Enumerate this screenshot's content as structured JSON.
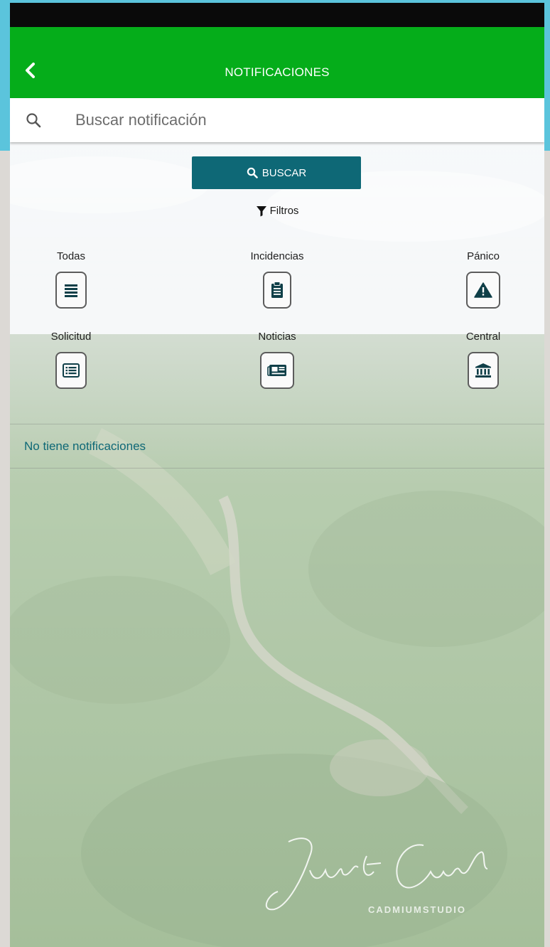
{
  "appbar": {
    "title": "NOTIFICACIONES",
    "back_icon": "chevron-left-icon"
  },
  "search": {
    "placeholder": "Buscar notificación",
    "value": ""
  },
  "actions": {
    "buscar_label": "BUSCAR",
    "filtros_label": "Filtros"
  },
  "categories": [
    {
      "label": "Todas",
      "icon": "list-icon"
    },
    {
      "label": "Incidencias",
      "icon": "clipboard-icon"
    },
    {
      "label": "Pánico",
      "icon": "warning-icon"
    },
    {
      "label": "Solicitud",
      "icon": "list-alt-icon"
    },
    {
      "label": "Noticias",
      "icon": "newspaper-icon"
    },
    {
      "label": "Central",
      "icon": "bank-icon"
    }
  ],
  "notifications": {
    "empty_message": "No tiene notificaciones"
  },
  "watermark": {
    "studio": "CADMIUMSTUDIO"
  },
  "colors": {
    "appbar": "#05ad1a",
    "primary_button": "#0e6876",
    "empty_text": "#0e6876",
    "statusbar": "#0a0a0a",
    "frame_top": "#5bc4dc"
  }
}
